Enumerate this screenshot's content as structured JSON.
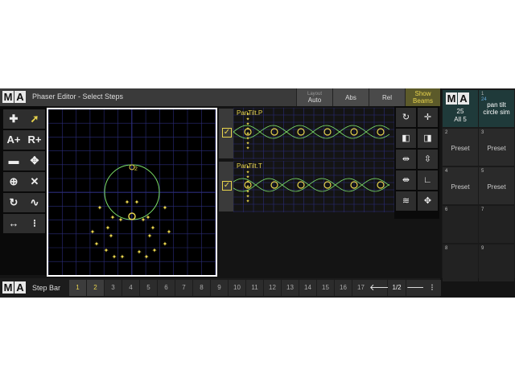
{
  "titlebar": {
    "title": "Phaser Editor - Select Steps",
    "layout_label": "Layout",
    "layout_value": "Auto",
    "abs": "Abs",
    "rel": "Rel",
    "show_beams_1": "Show",
    "show_beams_2": "Beams"
  },
  "tools": [
    "add-step",
    "select",
    "A+",
    "R+",
    "minus",
    "move",
    "center",
    "scale",
    "rotate",
    "wave",
    "spread",
    "step-dots"
  ],
  "tool_labels": {
    "a_plus": "A+",
    "r_plus": "R+"
  },
  "lanes": [
    {
      "name": "PanTilt.P"
    },
    {
      "name": "PanTilt.T"
    }
  ],
  "grid_label": "2",
  "stepbar": {
    "label": "Step Bar",
    "steps": [
      "1",
      "2",
      "3",
      "4",
      "5",
      "6",
      "7",
      "8",
      "9",
      "10",
      "11",
      "12",
      "13",
      "14",
      "15",
      "16",
      "17"
    ],
    "active_steps": [
      "1",
      "2"
    ],
    "page": "1/2"
  },
  "presets": {
    "header": {
      "num": "25",
      "label": "All 5"
    },
    "cells": [
      {
        "n": "1",
        "sub": "24",
        "text": "pan tilt circle sim"
      },
      {
        "n": "2",
        "text": "Preset"
      },
      {
        "n": "3",
        "text": "Preset"
      },
      {
        "n": "4",
        "text": "Preset"
      },
      {
        "n": "5",
        "text": "Preset"
      },
      {
        "n": "6",
        "text": ""
      },
      {
        "n": "7",
        "text": ""
      },
      {
        "n": "8",
        "text": ""
      },
      {
        "n": "9",
        "text": ""
      }
    ]
  },
  "colors": {
    "accent": "#e8d44d",
    "grid": "#2b2c7a",
    "circle": "#7ee36a"
  }
}
